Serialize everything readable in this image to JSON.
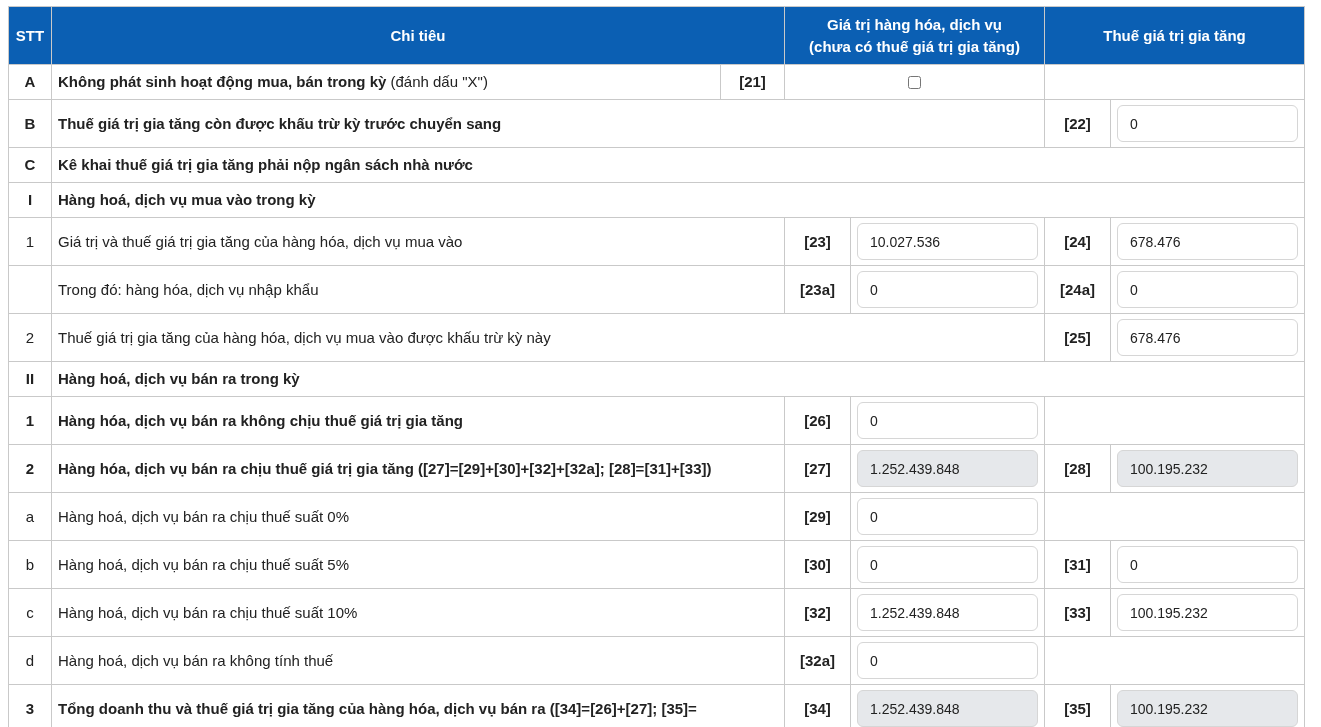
{
  "table": {
    "columns": [
      "STT",
      "Chi tiêu",
      "Giá trị hàng hóa, dịch vụ\n(chưa có thuế giá trị gia tăng)",
      "Thuế giá trị gia tăng"
    ],
    "rows": [
      {
        "kind": "checkbox",
        "stt": "A",
        "label": "**Không phát sinh hoạt động mua, bán trong kỳ** (đánh dấu \"X\")",
        "bold": false,
        "code": "[21]",
        "checked": false
      },
      {
        "kind": "tax_only",
        "stt": "B",
        "label": "Thuế giá trị gia tăng còn được khấu trừ kỳ trước chuyển sang",
        "bold": true,
        "tax": {
          "code": "[22]",
          "text": "0",
          "readonly": false
        }
      },
      {
        "kind": "section",
        "stt": "C",
        "label": "Kê khai thuế giá trị gia tăng phải nộp ngân sách nhà nước",
        "bold": true
      },
      {
        "kind": "section",
        "stt": "I",
        "label": "Hàng hoá, dịch vụ mua vào trong kỳ",
        "bold": true
      },
      {
        "kind": "both",
        "stt": "1",
        "label": "Giá trị và thuế giá trị gia tăng của hàng hóa, dịch vụ mua vào",
        "bold": false,
        "value": {
          "code": "[23]",
          "text": "10.027.536",
          "readonly": false
        },
        "tax": {
          "code": "[24]",
          "text": "678.476",
          "readonly": false
        }
      },
      {
        "kind": "both",
        "label": "Trong đó: hàng hóa, dịch vụ nhập khẩu",
        "bold": false,
        "value": {
          "code": "[23a]",
          "text": "0",
          "readonly": false
        },
        "tax": {
          "code": "[24a]",
          "text": "0",
          "readonly": false
        }
      },
      {
        "kind": "tax_only",
        "stt": "2",
        "label": "Thuế giá trị gia tăng của hàng hóa, dịch vụ mua vào được khấu trừ kỳ này",
        "bold": false,
        "tax": {
          "code": "[25]",
          "text": "678.476",
          "readonly": false
        }
      },
      {
        "kind": "section",
        "stt": "II",
        "label": "Hàng hoá, dịch vụ bán ra trong kỳ",
        "bold": true
      },
      {
        "kind": "both",
        "stt": "1",
        "label": "Hàng hóa, dịch vụ bán ra không chịu thuế giá trị gia tăng",
        "bold": true,
        "value": {
          "code": "[26]",
          "text": "0",
          "readonly": false
        }
      },
      {
        "kind": "both",
        "stt": "2",
        "label": "Hàng hóa, dịch vụ bán ra chịu thuế giá trị gia tăng ([27]=[29]+[30]+[32]+[32a]; [28]=[31]+[33])",
        "bold": true,
        "value": {
          "code": "[27]",
          "text": "1.252.439.848",
          "readonly": true
        },
        "tax": {
          "code": "[28]",
          "text": "100.195.232",
          "readonly": true
        }
      },
      {
        "kind": "both",
        "stt": "a",
        "label": "Hàng hoá, dịch vụ bán ra chịu thuế suất 0%",
        "bold": false,
        "value": {
          "code": "[29]",
          "text": "0",
          "readonly": false
        }
      },
      {
        "kind": "both",
        "stt": "b",
        "label": "Hàng hoá, dịch vụ bán ra chịu thuế suất 5%",
        "bold": false,
        "value": {
          "code": "[30]",
          "text": "0",
          "readonly": false
        },
        "tax": {
          "code": "[31]",
          "text": "0",
          "readonly": false
        }
      },
      {
        "kind": "both",
        "stt": "c",
        "label": "Hàng hoá, dịch vụ bán ra chịu thuế suất 10%",
        "bold": false,
        "value": {
          "code": "[32]",
          "text": "1.252.439.848",
          "readonly": false
        },
        "tax": {
          "code": "[33]",
          "text": "100.195.232",
          "readonly": false
        }
      },
      {
        "kind": "both",
        "stt": "d",
        "label": "Hàng hoá, dịch vụ bán ra không tính thuế",
        "bold": false,
        "value": {
          "code": "[32a]",
          "text": "0",
          "readonly": false
        }
      },
      {
        "kind": "both",
        "stt": "3",
        "label": "Tổng doanh thu và thuế giá trị gia tăng của hàng hóa, dịch vụ bán ra ([34]=[26]+[27]; [35]=",
        "bold": true,
        "value": {
          "code": "[34]",
          "text": "1.252.439.848",
          "readonly": true
        },
        "tax": {
          "code": "[35]",
          "text": "100.195.232",
          "readonly": true
        }
      }
    ]
  }
}
